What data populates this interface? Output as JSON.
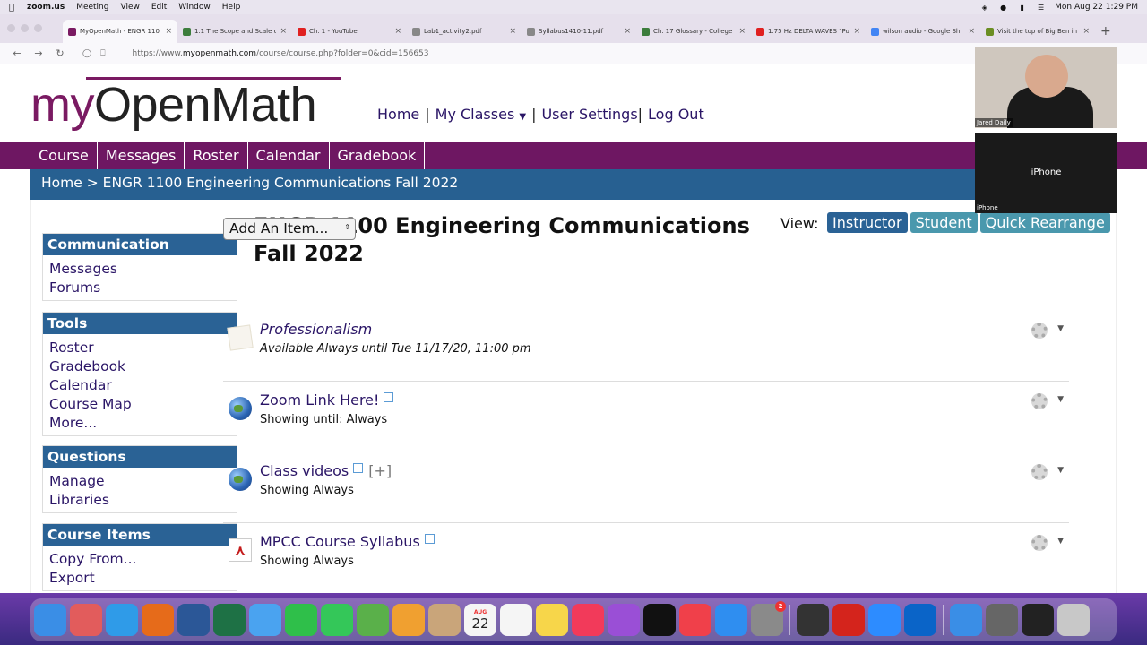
{
  "menubar": {
    "app": "zoom.us",
    "items": [
      "Meeting",
      "View",
      "Edit",
      "Window",
      "Help"
    ],
    "clock": "Mon Aug 22  1:29 PM"
  },
  "tabs": [
    {
      "label": "MyOpenMath - ENGR 110",
      "color": "#7a1a62",
      "active": true
    },
    {
      "label": "1.1 The Scope and Scale o",
      "color": "#3c7d3c",
      "active": false
    },
    {
      "label": "Ch. 1 - YouTube",
      "color": "#e02020",
      "active": false
    },
    {
      "label": "Lab1_activity2.pdf",
      "color": "#888888",
      "active": false
    },
    {
      "label": "Syllabus1410-11.pdf",
      "color": "#888888",
      "active": false
    },
    {
      "label": "Ch. 17 Glossary - College",
      "color": "#3c7d3c",
      "active": false
    },
    {
      "label": "1.75 Hz DELTA WAVES \"Pu",
      "color": "#e02020",
      "active": false
    },
    {
      "label": "wilson audio - Google Sh",
      "color": "#4285f4",
      "active": false
    },
    {
      "label": "Visit the top of Big Ben in",
      "color": "#6b8e23",
      "active": false
    }
  ],
  "url": {
    "prefix": "https://www.",
    "domain": "myopenmath.com",
    "path": "/course/course.php?folder=0&cid=156653"
  },
  "logo": {
    "my": "my",
    "rest": "OpenMath"
  },
  "topnav": {
    "home": "Home",
    "sep1": "|",
    "classes": "My Classes",
    "sep2": "|",
    "settings": "User Settings",
    "sep3": "|",
    "logout": "Log Out"
  },
  "mainnav": [
    "Course",
    "Messages",
    "Roster",
    "Calendar",
    "Gradebook"
  ],
  "breadcrumb": {
    "home": "Home",
    "sep": ">",
    "course": "ENGR 1100 Engineering Communications Fall 2022"
  },
  "sidebar": [
    {
      "header": "Communication",
      "links": [
        "Messages",
        "Forums"
      ]
    },
    {
      "header": "Tools",
      "links": [
        "Roster",
        "Gradebook",
        "Calendar",
        "Course Map",
        "More..."
      ]
    },
    {
      "header": "Questions",
      "links": [
        "Manage",
        "Libraries"
      ]
    },
    {
      "header": "Course Items",
      "links": [
        "Copy From...",
        "Export"
      ]
    }
  ],
  "page_title": "ENGR 1100 Engineering Communications Fall 2022",
  "view": {
    "label": "View:",
    "buttons": [
      "Instructor",
      "Student",
      "Quick Rearrange"
    ]
  },
  "add_item": "Add An Item...",
  "items": [
    {
      "name": "Professionalism",
      "sub": "Available Always until Tue 11/17/20, 11:00 pm",
      "icon": "document-icon",
      "italic": true,
      "link": false,
      "expand": ""
    },
    {
      "name": "Zoom Link Here!",
      "sub": "Showing until: Always",
      "icon": "globe-icon",
      "italic": false,
      "link": true,
      "expand": ""
    },
    {
      "name": "Class videos",
      "sub": "Showing Always",
      "icon": "globe-icon",
      "italic": false,
      "link": true,
      "expand": "[+]"
    },
    {
      "name": "MPCC Course Syllabus",
      "sub": "Showing Always",
      "icon": "pdf-icon",
      "italic": false,
      "link": true,
      "expand": ""
    }
  ],
  "zoom": {
    "participant1": "Jared Daily",
    "participant2": "iPhone",
    "participant2_center": "iPhone"
  },
  "dock": [
    {
      "name": "finder-icon",
      "color": "#3a8ee6"
    },
    {
      "name": "launchpad-icon",
      "color": "#e25c5c"
    },
    {
      "name": "safari-icon",
      "color": "#2f9be8"
    },
    {
      "name": "firefox-icon",
      "color": "#e66b1a"
    },
    {
      "name": "word-icon",
      "color": "#2b5797"
    },
    {
      "name": "excel-icon",
      "color": "#1e7145"
    },
    {
      "name": "mail-icon",
      "color": "#4aa3f0"
    },
    {
      "name": "facetime-icon",
      "color": "#2fbf4a"
    },
    {
      "name": "messages-icon",
      "color": "#34c759"
    },
    {
      "name": "maps-icon",
      "color": "#5ab04a"
    },
    {
      "name": "photos-icon",
      "color": "#f0a030"
    },
    {
      "name": "contacts-icon",
      "color": "#c9a57a"
    },
    {
      "name": "calendar-icon",
      "color": "#f5f5f5"
    },
    {
      "name": "reminders-icon",
      "color": "#f5f5f5"
    },
    {
      "name": "notes-icon",
      "color": "#f7d64a"
    },
    {
      "name": "music-icon",
      "color": "#f23a5a"
    },
    {
      "name": "podcasts-icon",
      "color": "#9a4fd6"
    },
    {
      "name": "tv-icon",
      "color": "#111111"
    },
    {
      "name": "news-icon",
      "color": "#f0404a"
    },
    {
      "name": "appstore-icon",
      "color": "#2f8ef0"
    },
    {
      "name": "settings-icon",
      "color": "#8a8a8a"
    },
    {
      "name": "qr-icon",
      "color": "#333333"
    },
    {
      "name": "acrobat-icon",
      "color": "#d4241c"
    },
    {
      "name": "zoom-icon",
      "color": "#2d8cff"
    },
    {
      "name": "outlook-icon",
      "color": "#0a64c8"
    },
    {
      "name": "downloads-icon",
      "color": "#3a8ee6"
    },
    {
      "name": "screenshot-icon",
      "color": "#666666"
    },
    {
      "name": "terminal-icon",
      "color": "#222222"
    },
    {
      "name": "trash-icon",
      "color": "#c8c8c8"
    }
  ],
  "calendar_day": {
    "month": "AUG",
    "day": "22"
  },
  "notif_badge": "2"
}
